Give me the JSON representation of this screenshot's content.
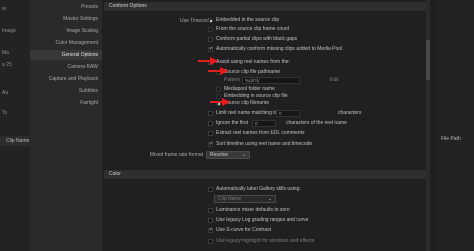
{
  "window": {
    "left_panel": {
      "items": [
        "er",
        "Image",
        "Ma",
        "a 25",
        "Au",
        "Ts"
      ],
      "clip_name_header": "Clip Name"
    },
    "right_panel": {
      "file_path_header": "File Path"
    }
  },
  "sidebar": {
    "items": [
      {
        "label": "Presets"
      },
      {
        "label": "Master Settings"
      },
      {
        "label": "Image Scaling"
      },
      {
        "label": "Color Management"
      },
      {
        "label": "General Options"
      },
      {
        "label": "Camera RAW"
      },
      {
        "label": "Capture and Playback"
      },
      {
        "label": "Subtitles"
      },
      {
        "label": "Fairlight"
      }
    ],
    "active_index": 4
  },
  "conform": {
    "header": "Conform Options",
    "use_timecode_label": "Use Timecode",
    "timecode_options": [
      "Embedded in the source clip",
      "From the source clip frame count"
    ],
    "timecode_selected": 0,
    "conform_black_gaps": "Conform partial clips with black gaps",
    "auto_conform_missing": "Automatically conform missing clips added to Media Pool",
    "assist_reel_names": "Assist using reel names from the:",
    "reel_options": [
      {
        "label": "Source clip file pathname"
      },
      {
        "label": "Mediapool folder name"
      },
      {
        "label": "Embedding in source clip file"
      },
      {
        "label": "Source clip filename"
      }
    ],
    "reel_selected": 3,
    "pattern_label": "Pattern",
    "pattern_value": "%(d/?)/",
    "pattern_action": "Edit",
    "limit_reel_name_label": "Limit reel name matching to",
    "limit_reel_name_value": "0",
    "limit_reel_name_suffix": "characters",
    "ignore_first_label": "Ignore the first",
    "ignore_first_value": "0",
    "ignore_first_suffix": "characters of the reel name",
    "extract_reel_names": "Extract reel names from EDL comments",
    "sort_timeline": "Sort timeline using reel name and timecode",
    "mixed_frame_rate_label": "Mixed frame rate format",
    "mixed_frame_rate_value": "Resolve"
  },
  "color": {
    "header": "Color",
    "auto_label_gallery": "Automatically label Gallery stills using:",
    "clip_name_dropdown": "Clip Name",
    "luminance_mixer": "Luminance mixer defaults to zero",
    "legacy_log": "Use legacy Log grading ranges and curve",
    "s_curve": "Use S-curve for Contrast",
    "legacy_mixer": "Use legacy highlight for windows and effects"
  }
}
